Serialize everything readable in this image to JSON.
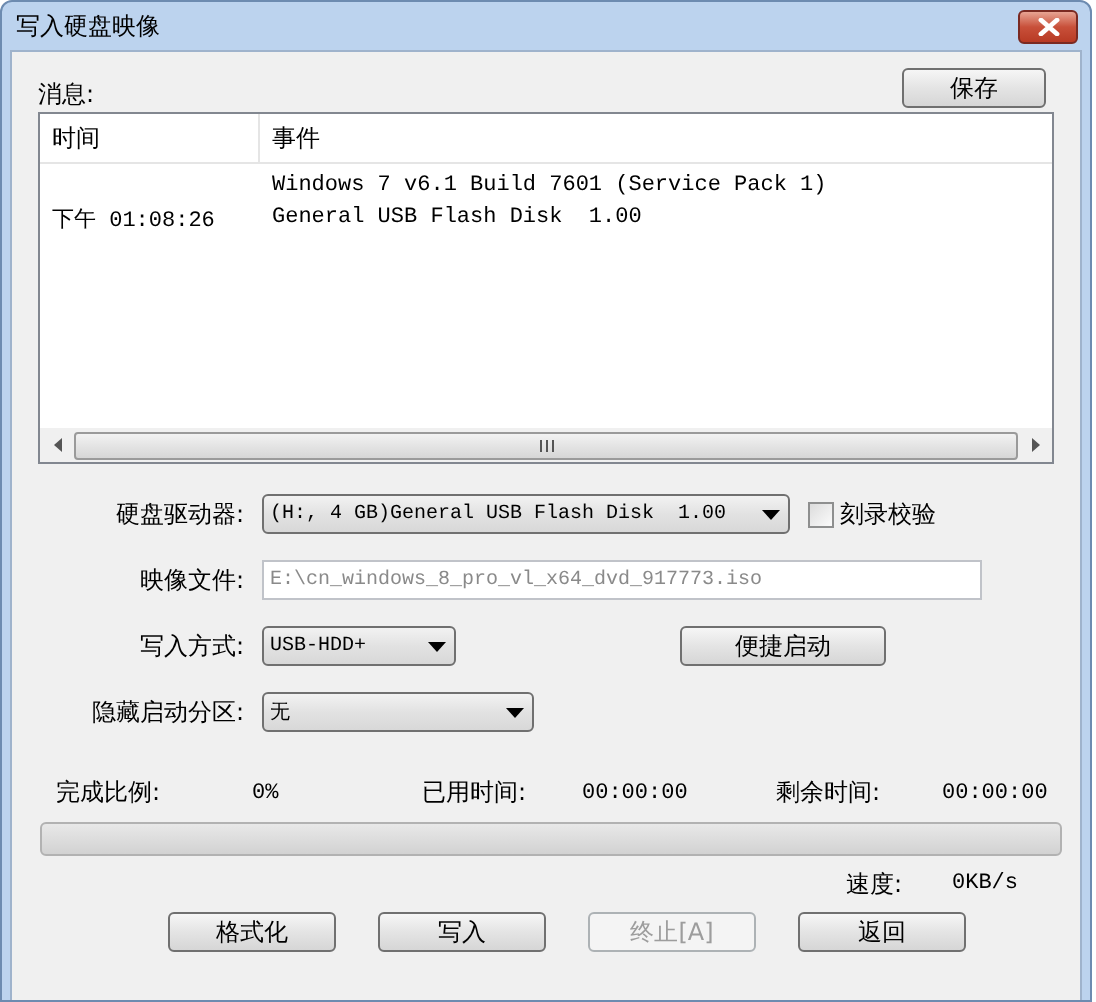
{
  "window": {
    "title": "写入硬盘映像"
  },
  "messages": {
    "label": "消息:",
    "save_button": "保存",
    "columns": [
      "时间",
      "事件"
    ],
    "rows": [
      {
        "event": "Windows 7 v6.1 Build 7601 (Service Pack 1)"
      },
      {
        "time": "下午 01:08:26",
        "event": "General USB Flash Disk  1.00"
      }
    ]
  },
  "form": {
    "drive": {
      "label": "硬盘驱动器:",
      "value": "(H:, 4 GB)General USB Flash Disk  1.00"
    },
    "verify": {
      "label": "刻录校验",
      "checked": false
    },
    "image_file": {
      "label": "映像文件:",
      "value": "E:\\cn_windows_8_pro_vl_x64_dvd_917773.iso",
      "disabled": true
    },
    "write_mode": {
      "label": "写入方式:",
      "value": "USB-HDD+"
    },
    "quick_boot_button": "便捷启动",
    "hide_partition": {
      "label": "隐藏启动分区:",
      "value": "无"
    }
  },
  "progress": {
    "percent_label": "完成比例:",
    "percent": "0%",
    "elapsed_label": "已用时间:",
    "elapsed": "00:00:00",
    "remaining_label": "剩余时间:",
    "remaining": "00:00:00",
    "level": 0,
    "speed_label": "速度:",
    "speed": "0KB/s"
  },
  "buttons": [
    {
      "label": "格式化",
      "disabled": false
    },
    {
      "label": "写入",
      "disabled": false
    },
    {
      "label": "终止[A]",
      "disabled": true
    },
    {
      "label": "返回",
      "disabled": false
    }
  ]
}
